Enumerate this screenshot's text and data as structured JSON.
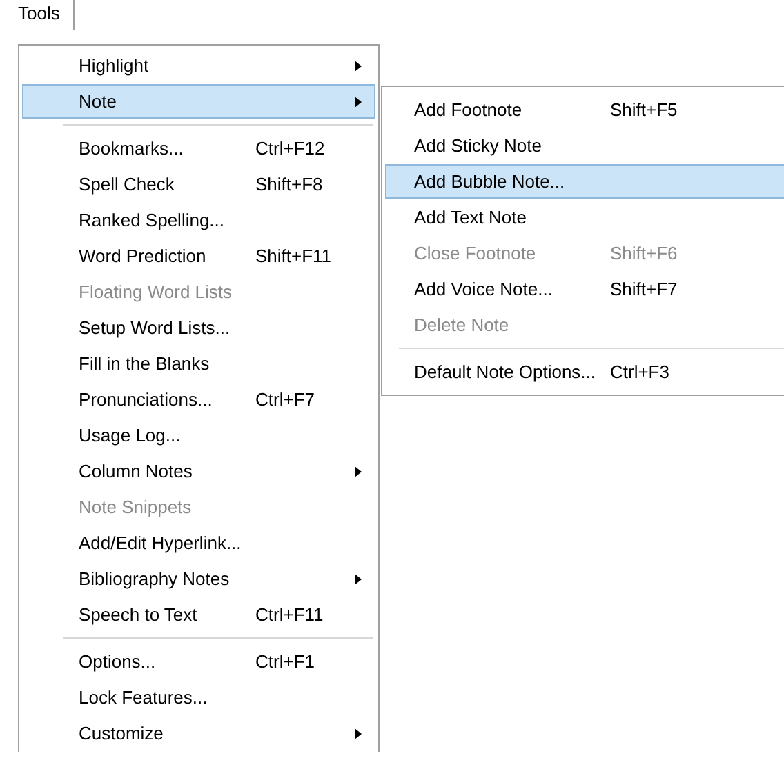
{
  "menubar": [
    {
      "label": "Tools",
      "selected": true
    }
  ],
  "menu": [
    {
      "kind": "item",
      "label": "Highlight",
      "has_submenu": true,
      "disabled": false,
      "selected": false
    },
    {
      "kind": "item",
      "label": "Note",
      "has_submenu": true,
      "disabled": false,
      "selected": true
    },
    {
      "kind": "separator"
    },
    {
      "kind": "item",
      "label": "Bookmarks...",
      "shortcut": "Ctrl+F12",
      "disabled": false,
      "selected": false
    },
    {
      "kind": "item",
      "label": "Spell Check",
      "shortcut": "Shift+F8",
      "disabled": false,
      "selected": false
    },
    {
      "kind": "item",
      "label": "Ranked Spelling...",
      "disabled": false,
      "selected": false
    },
    {
      "kind": "item",
      "label": "Word Prediction",
      "shortcut": "Shift+F11",
      "disabled": false,
      "selected": false
    },
    {
      "kind": "item",
      "label": "Floating Word Lists",
      "disabled": true,
      "selected": false
    },
    {
      "kind": "item",
      "label": "Setup Word Lists...",
      "disabled": false,
      "selected": false
    },
    {
      "kind": "item",
      "label": "Fill in the Blanks",
      "disabled": false,
      "selected": false
    },
    {
      "kind": "item",
      "label": "Pronunciations...",
      "shortcut": "Ctrl+F7",
      "disabled": false,
      "selected": false
    },
    {
      "kind": "item",
      "label": "Usage Log...",
      "disabled": false,
      "selected": false
    },
    {
      "kind": "item",
      "label": "Column Notes",
      "has_submenu": true,
      "disabled": false,
      "selected": false
    },
    {
      "kind": "item",
      "label": "Note Snippets",
      "disabled": true,
      "selected": false
    },
    {
      "kind": "item",
      "label": "Add/Edit Hyperlink...",
      "disabled": false,
      "selected": false
    },
    {
      "kind": "item",
      "label": "Bibliography Notes",
      "has_submenu": true,
      "disabled": false,
      "selected": false
    },
    {
      "kind": "item",
      "label": "Speech to Text",
      "shortcut": "Ctrl+F11",
      "disabled": false,
      "selected": false
    },
    {
      "kind": "separator"
    },
    {
      "kind": "item",
      "label": "Options...",
      "shortcut": "Ctrl+F1",
      "disabled": false,
      "selected": false
    },
    {
      "kind": "item",
      "label": "Lock Features...",
      "disabled": false,
      "selected": false
    },
    {
      "kind": "item",
      "label": "Customize",
      "has_submenu": true,
      "disabled": false,
      "selected": false
    }
  ],
  "submenu": [
    {
      "kind": "item",
      "label": "Add Footnote",
      "shortcut": "Shift+F5",
      "disabled": false,
      "selected": false
    },
    {
      "kind": "item",
      "label": "Add Sticky Note",
      "disabled": false,
      "selected": false
    },
    {
      "kind": "item",
      "label": "Add Bubble Note...",
      "disabled": false,
      "selected": true
    },
    {
      "kind": "item",
      "label": "Add Text Note",
      "disabled": false,
      "selected": false
    },
    {
      "kind": "item",
      "label": "Close Footnote",
      "shortcut": "Shift+F6",
      "disabled": true,
      "selected": false
    },
    {
      "kind": "item",
      "label": "Add Voice Note...",
      "shortcut": "Shift+F7",
      "disabled": false,
      "selected": false
    },
    {
      "kind": "item",
      "label": "Delete Note",
      "disabled": true,
      "selected": false
    },
    {
      "kind": "separator"
    },
    {
      "kind": "item",
      "label": "Default Note Options...",
      "shortcut": "Ctrl+F3",
      "disabled": false,
      "selected": false
    }
  ]
}
